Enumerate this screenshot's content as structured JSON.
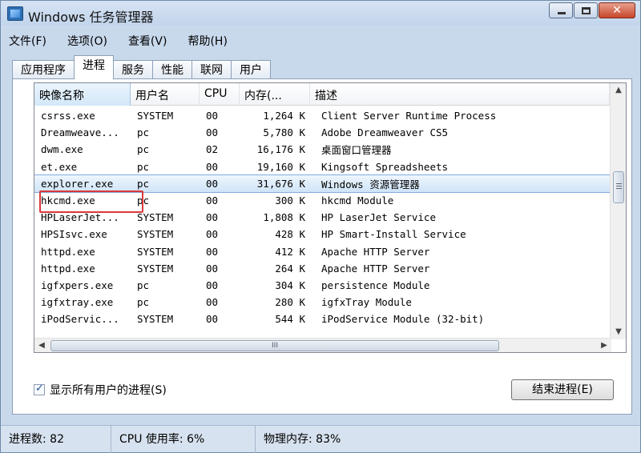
{
  "window": {
    "title": "Windows 任务管理器"
  },
  "menu": [
    "文件(F)",
    "选项(O)",
    "查看(V)",
    "帮助(H)"
  ],
  "tabs": [
    "应用程序",
    "进程",
    "服务",
    "性能",
    "联网",
    "用户"
  ],
  "active_tab": "进程",
  "columns": [
    "映像名称",
    "用户名",
    "CPU",
    "内存(...",
    "描述"
  ],
  "rows": [
    {
      "name": "csrss.exe",
      "user": "SYSTEM",
      "cpu": "00",
      "mem": "1,264 K",
      "desc": "Client Server Runtime Process"
    },
    {
      "name": "Dreamweave...",
      "user": "pc",
      "cpu": "00",
      "mem": "5,780 K",
      "desc": "Adobe Dreamweaver CS5"
    },
    {
      "name": "dwm.exe",
      "user": "pc",
      "cpu": "02",
      "mem": "16,176 K",
      "desc": "桌面窗口管理器"
    },
    {
      "name": "et.exe",
      "user": "pc",
      "cpu": "00",
      "mem": "19,160 K",
      "desc": "Kingsoft Spreadsheets"
    },
    {
      "name": "explorer.exe",
      "user": "pc",
      "cpu": "00",
      "mem": "31,676 K",
      "desc": "Windows 资源管理器"
    },
    {
      "name": "hkcmd.exe",
      "user": "pc",
      "cpu": "00",
      "mem": "300 K",
      "desc": "hkcmd Module"
    },
    {
      "name": "HPLaserJet...",
      "user": "SYSTEM",
      "cpu": "00",
      "mem": "1,808 K",
      "desc": "HP LaserJet Service"
    },
    {
      "name": "HPSIsvc.exe",
      "user": "SYSTEM",
      "cpu": "00",
      "mem": "428 K",
      "desc": "HP Smart-Install Service"
    },
    {
      "name": "httpd.exe",
      "user": "SYSTEM",
      "cpu": "00",
      "mem": "412 K",
      "desc": "Apache HTTP Server"
    },
    {
      "name": "httpd.exe",
      "user": "SYSTEM",
      "cpu": "00",
      "mem": "264 K",
      "desc": "Apache HTTP Server"
    },
    {
      "name": "igfxpers.exe",
      "user": "pc",
      "cpu": "00",
      "mem": "304 K",
      "desc": "persistence Module"
    },
    {
      "name": "igfxtray.exe",
      "user": "pc",
      "cpu": "00",
      "mem": "280 K",
      "desc": "igfxTray Module"
    },
    {
      "name": "iPodServic...",
      "user": "SYSTEM",
      "cpu": "00",
      "mem": "544 K",
      "desc": "iPodService Module (32-bit)"
    }
  ],
  "selected_row": 4,
  "show_all_label": "显示所有用户的进程(S)",
  "show_all_checked": true,
  "end_process_label": "结束进程(E)",
  "status": {
    "processes": "进程数: 82",
    "cpu": "CPU 使用率: 6%",
    "memory": "物理内存: 83%"
  }
}
